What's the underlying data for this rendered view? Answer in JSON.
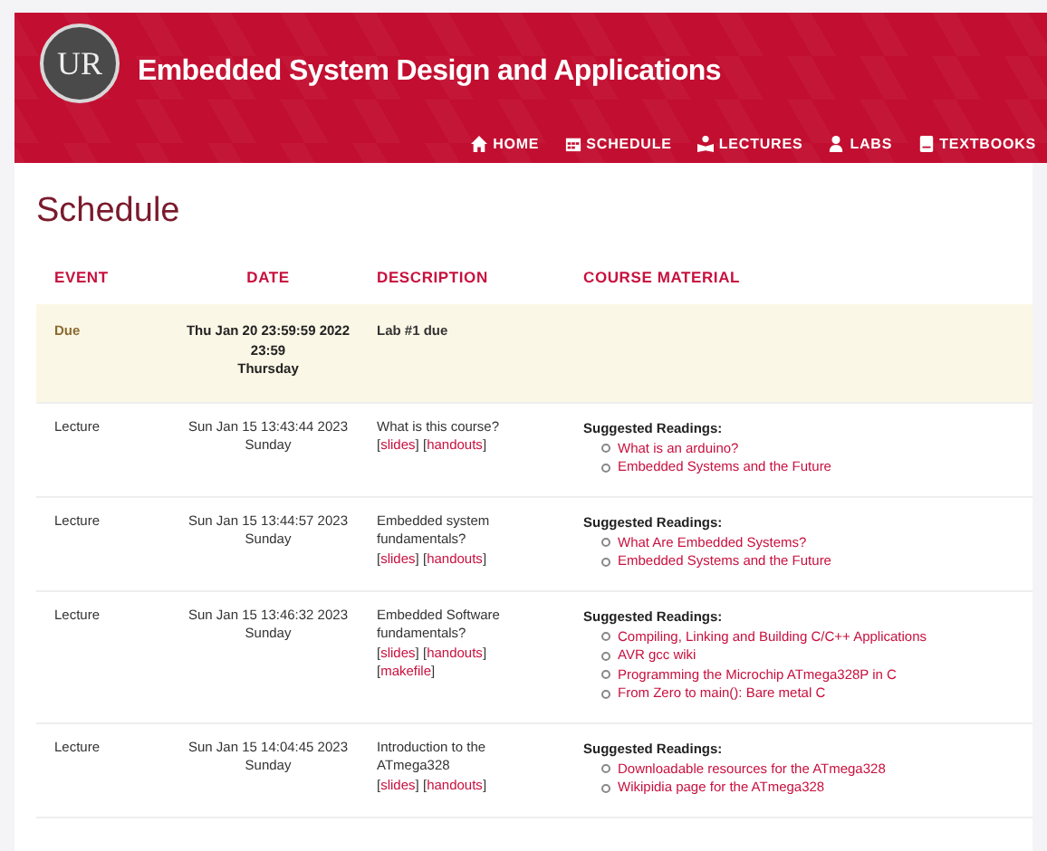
{
  "site": {
    "logo": "UR",
    "title": "Embedded System Design and Applications"
  },
  "nav": [
    {
      "label": "HOME",
      "kind": "home"
    },
    {
      "label": "SCHEDULE",
      "kind": "calendar"
    },
    {
      "label": "LECTURES",
      "kind": "lecture"
    },
    {
      "label": "LABS",
      "kind": "lab"
    },
    {
      "label": "TEXTBOOKS",
      "kind": "book"
    }
  ],
  "page_title": "Schedule",
  "columns": [
    "EVENT",
    "DATE",
    "DESCRIPTION",
    "COURSE MATERIAL"
  ],
  "rows": [
    {
      "kind": "due",
      "event": "Due",
      "date": [
        "Thu Jan 20 23:59:59 2022",
        "23:59",
        "Thursday"
      ],
      "description": "Lab #1 due",
      "links": [],
      "readings_title": "",
      "readings": []
    },
    {
      "kind": "lecture",
      "event": "Lecture",
      "date": [
        "Sun Jan 15 13:43:44 2023",
        "Sunday"
      ],
      "description": "What is this course?",
      "links": [
        [
          {
            "before": "[",
            "label": "slides",
            "after": "]"
          },
          {
            "before": "[",
            "label": "handouts",
            "after": "]"
          }
        ]
      ],
      "readings_title": "Suggested Readings:",
      "readings": [
        "What is an arduino?",
        "Embedded Systems and the Future"
      ]
    },
    {
      "kind": "lecture",
      "event": "Lecture",
      "date": [
        "Sun Jan 15 13:44:57 2023",
        "Sunday"
      ],
      "description": "Embedded system fundamentals?",
      "links": [
        [
          {
            "before": "[",
            "label": "slides",
            "after": "]"
          },
          {
            "before": "[",
            "label": "handouts",
            "after": "]"
          }
        ]
      ],
      "readings_title": "Suggested Readings:",
      "readings": [
        "What Are Embedded Systems?",
        "Embedded Systems and the Future"
      ]
    },
    {
      "kind": "lecture",
      "event": "Lecture",
      "date": [
        "Sun Jan 15 13:46:32 2023",
        "Sunday"
      ],
      "description": "Embedded Software fundamentals?",
      "links": [
        [
          {
            "before": "[",
            "label": "slides",
            "after": "]"
          },
          {
            "before": "[",
            "label": "handouts",
            "after": "]"
          }
        ],
        [
          {
            "before": "[",
            "label": "makefile",
            "after": "]"
          }
        ]
      ],
      "readings_title": "Suggested Readings:",
      "readings": [
        "Compiling, Linking and Building C/C++ Applications",
        "AVR gcc wiki",
        "Programming the Microchip ATmega328P in C",
        "From Zero to main(): Bare metal C"
      ]
    },
    {
      "kind": "lecture",
      "event": "Lecture",
      "date": [
        "Sun Jan 15 14:04:45 2023",
        "Sunday"
      ],
      "description": "Introduction to the ATmega328",
      "links": [
        [
          {
            "before": "[",
            "label": "slides",
            "after": "]"
          },
          {
            "before": "[",
            "label": "handouts",
            "after": "]"
          }
        ]
      ],
      "readings_title": "Suggested Readings:",
      "readings": [
        "Downloadable resources for the ATmega328",
        "Wikipidia page for the ATmega328"
      ]
    }
  ]
}
